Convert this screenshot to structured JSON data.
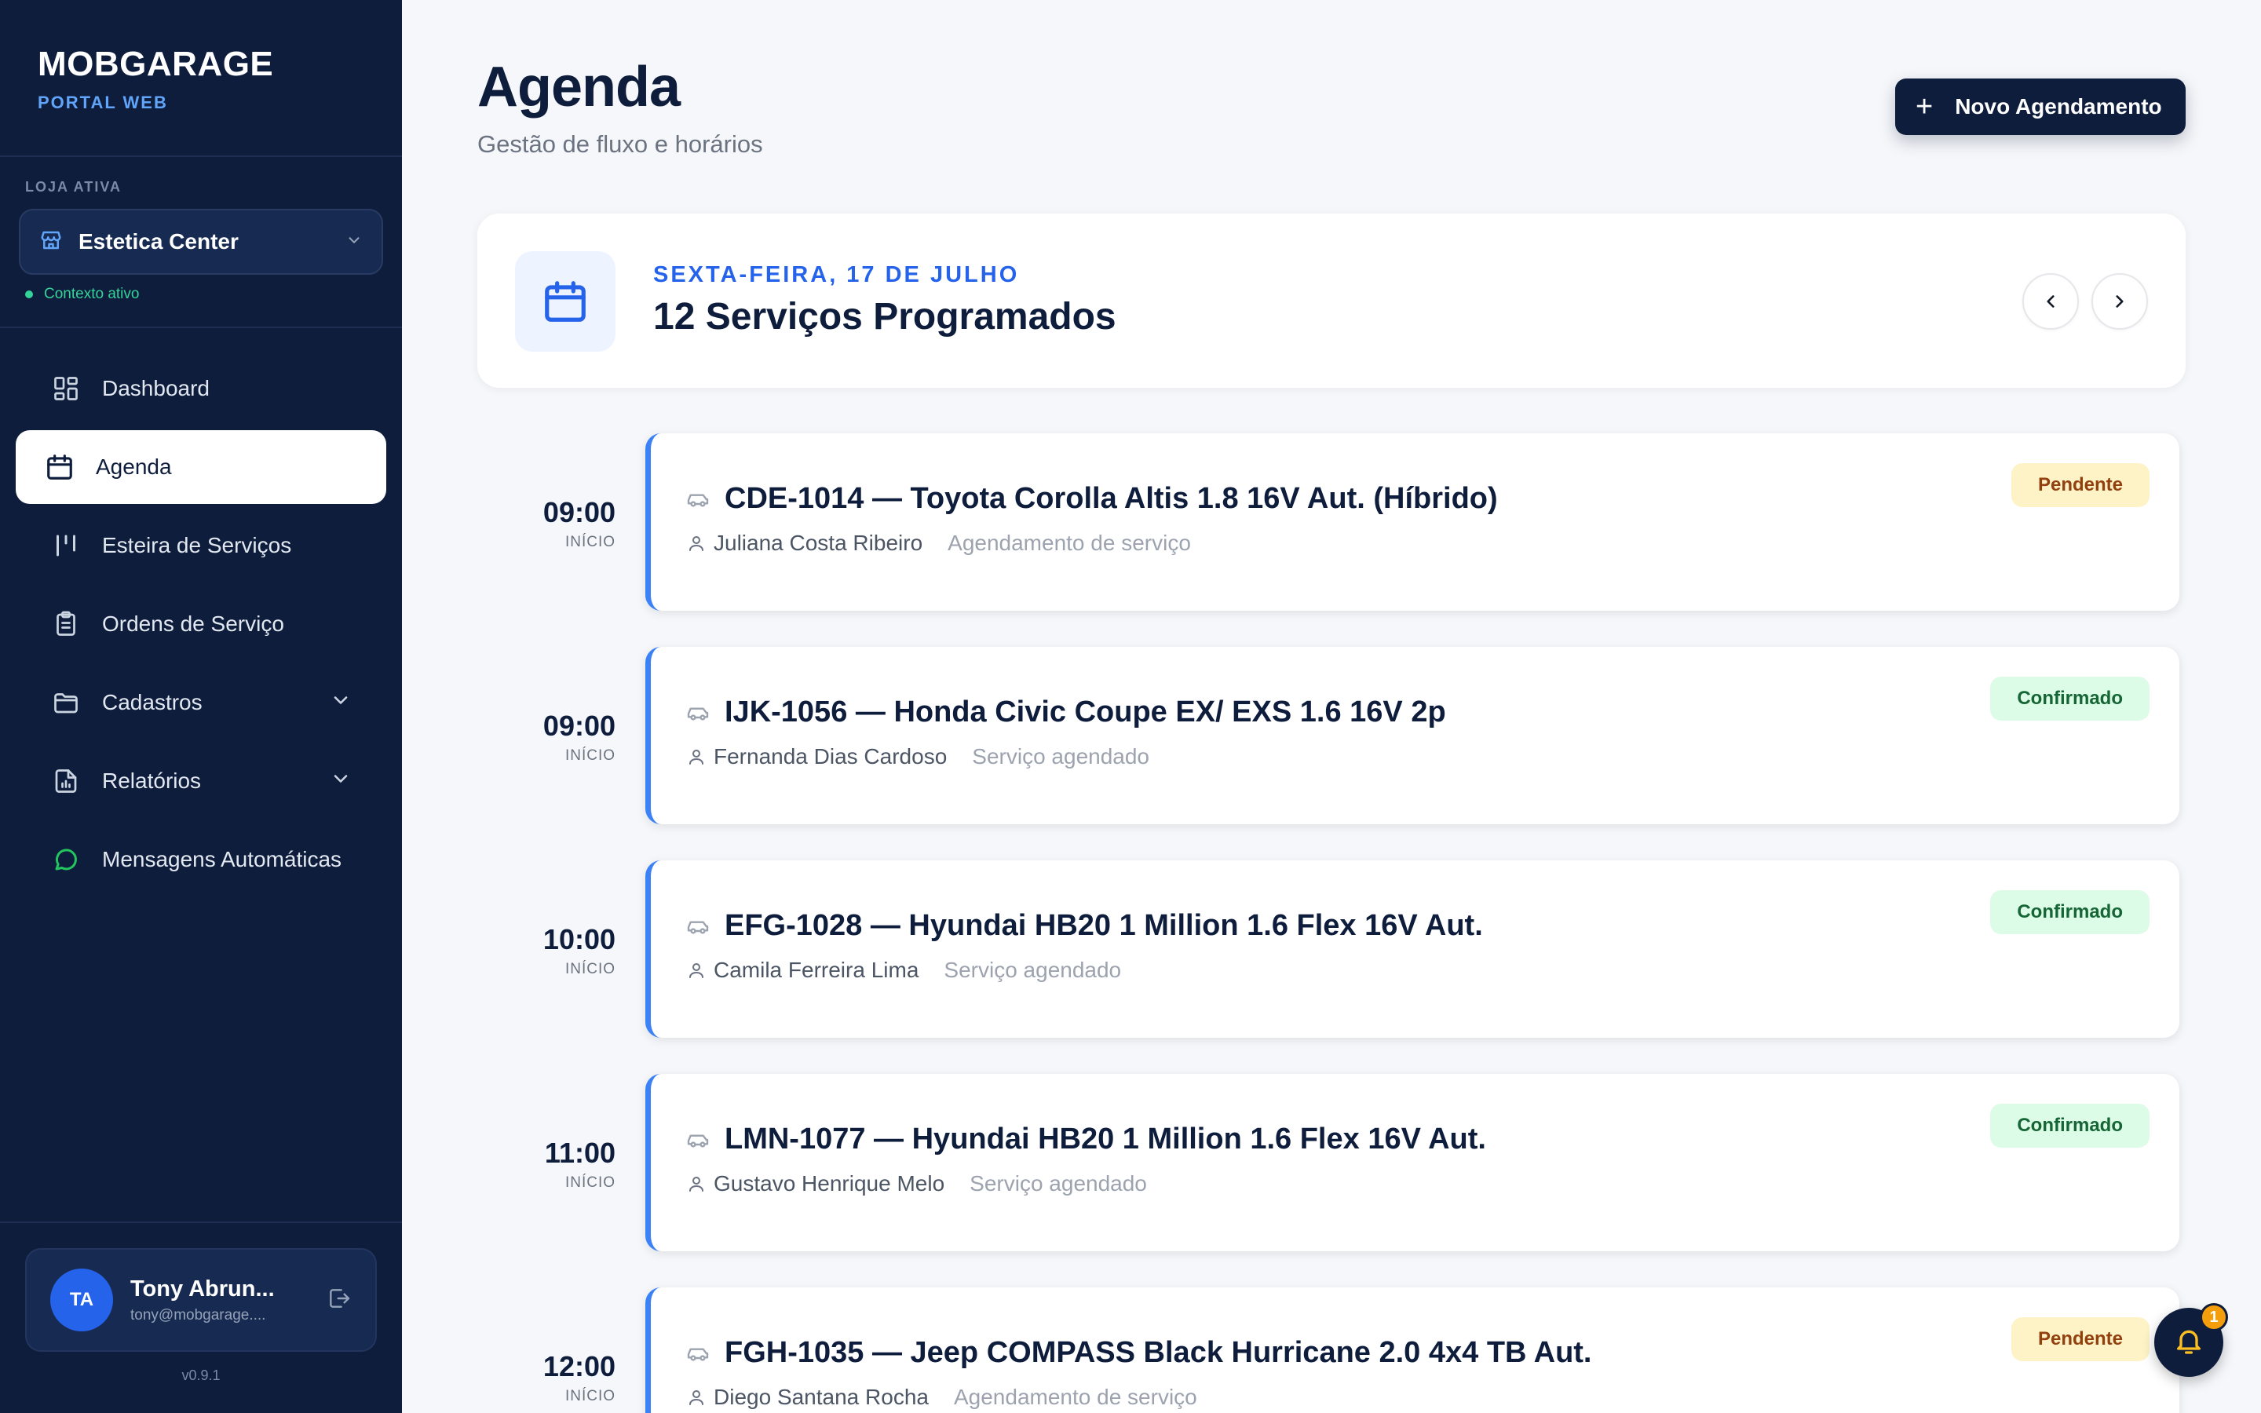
{
  "brand": {
    "title": "MOBGARAGE",
    "subtitle": "PORTAL WEB"
  },
  "store": {
    "label": "LOJA ATIVA",
    "name": "Estetica Center",
    "context": "Contexto ativo"
  },
  "nav": [
    {
      "label": "Dashboard",
      "icon": "dashboard-grid-icon"
    },
    {
      "label": "Agenda",
      "icon": "calendar-icon",
      "active": true
    },
    {
      "label": "Esteira de Serviços",
      "icon": "columns-icon"
    },
    {
      "label": "Ordens de Serviço",
      "icon": "clipboard-icon"
    },
    {
      "label": "Cadastros",
      "icon": "folder-icon",
      "expandable": true
    },
    {
      "label": "Relatórios",
      "icon": "report-icon",
      "expandable": true
    },
    {
      "label": "Mensagens Automáticas",
      "icon": "chat-icon"
    }
  ],
  "user": {
    "initials": "TA",
    "name": "Tony Abrun...",
    "email": "tony@mobgarage...."
  },
  "version": "v0.9.1",
  "header": {
    "title": "Agenda",
    "subtitle": "Gestão de fluxo e horários",
    "new_button": "Novo Agendamento"
  },
  "date_card": {
    "date": "SEXTA-FEIRA, 17 DE JULHO",
    "count": "12 Serviços Programados"
  },
  "time_label": "INÍCIO",
  "appointments": [
    {
      "time": "09:00",
      "title": "CDE-1014 — Toyota Corolla Altis 1.8 16V Aut. (Híbrido)",
      "client": "Juliana Costa Ribeiro",
      "desc": "Agendamento de serviço",
      "status": "Pendente"
    },
    {
      "time": "09:00",
      "title": "IJK-1056 — Honda Civic Coupe EX/ EXS 1.6 16V 2p",
      "client": "Fernanda Dias Cardoso",
      "desc": "Serviço agendado",
      "status": "Confirmado"
    },
    {
      "time": "10:00",
      "title": "EFG-1028 — Hyundai HB20 1 Million 1.6 Flex 16V Aut.",
      "client": "Camila Ferreira Lima",
      "desc": "Serviço agendado",
      "status": "Confirmado"
    },
    {
      "time": "11:00",
      "title": "LMN-1077 — Hyundai HB20 1 Million 1.6 Flex 16V Aut.",
      "client": "Gustavo Henrique Melo",
      "desc": "Serviço agendado",
      "status": "Confirmado"
    },
    {
      "time": "12:00",
      "title": "FGH-1035 — Jeep COMPASS Black Hurricane 2.0 4x4 TB Aut.",
      "client": "Diego Santana Rocha",
      "desc": "Agendamento de serviço",
      "status": "Pendente"
    }
  ],
  "notifications": {
    "count": "1"
  },
  "colors": {
    "sidebar": "#0f1d3d",
    "accent": "#2563eb",
    "pending": "#fef3c7",
    "confirmed": "#dcfce7"
  }
}
